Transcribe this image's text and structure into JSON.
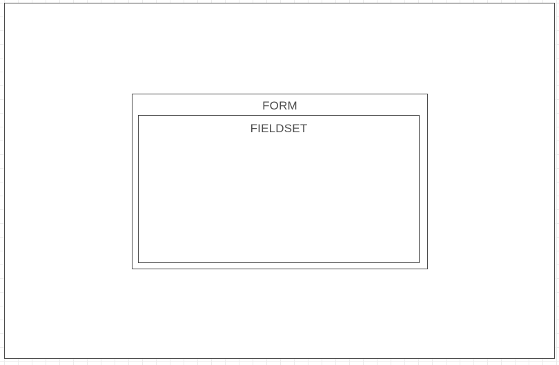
{
  "diagram": {
    "form": {
      "label": "FORM",
      "children": {
        "fieldset": {
          "label": "FIELDSET"
        }
      }
    }
  },
  "colors": {
    "border": "#4a4a4a",
    "label_text": "#4d4d4d",
    "grid": "#ececec",
    "background": "#ffffff"
  }
}
